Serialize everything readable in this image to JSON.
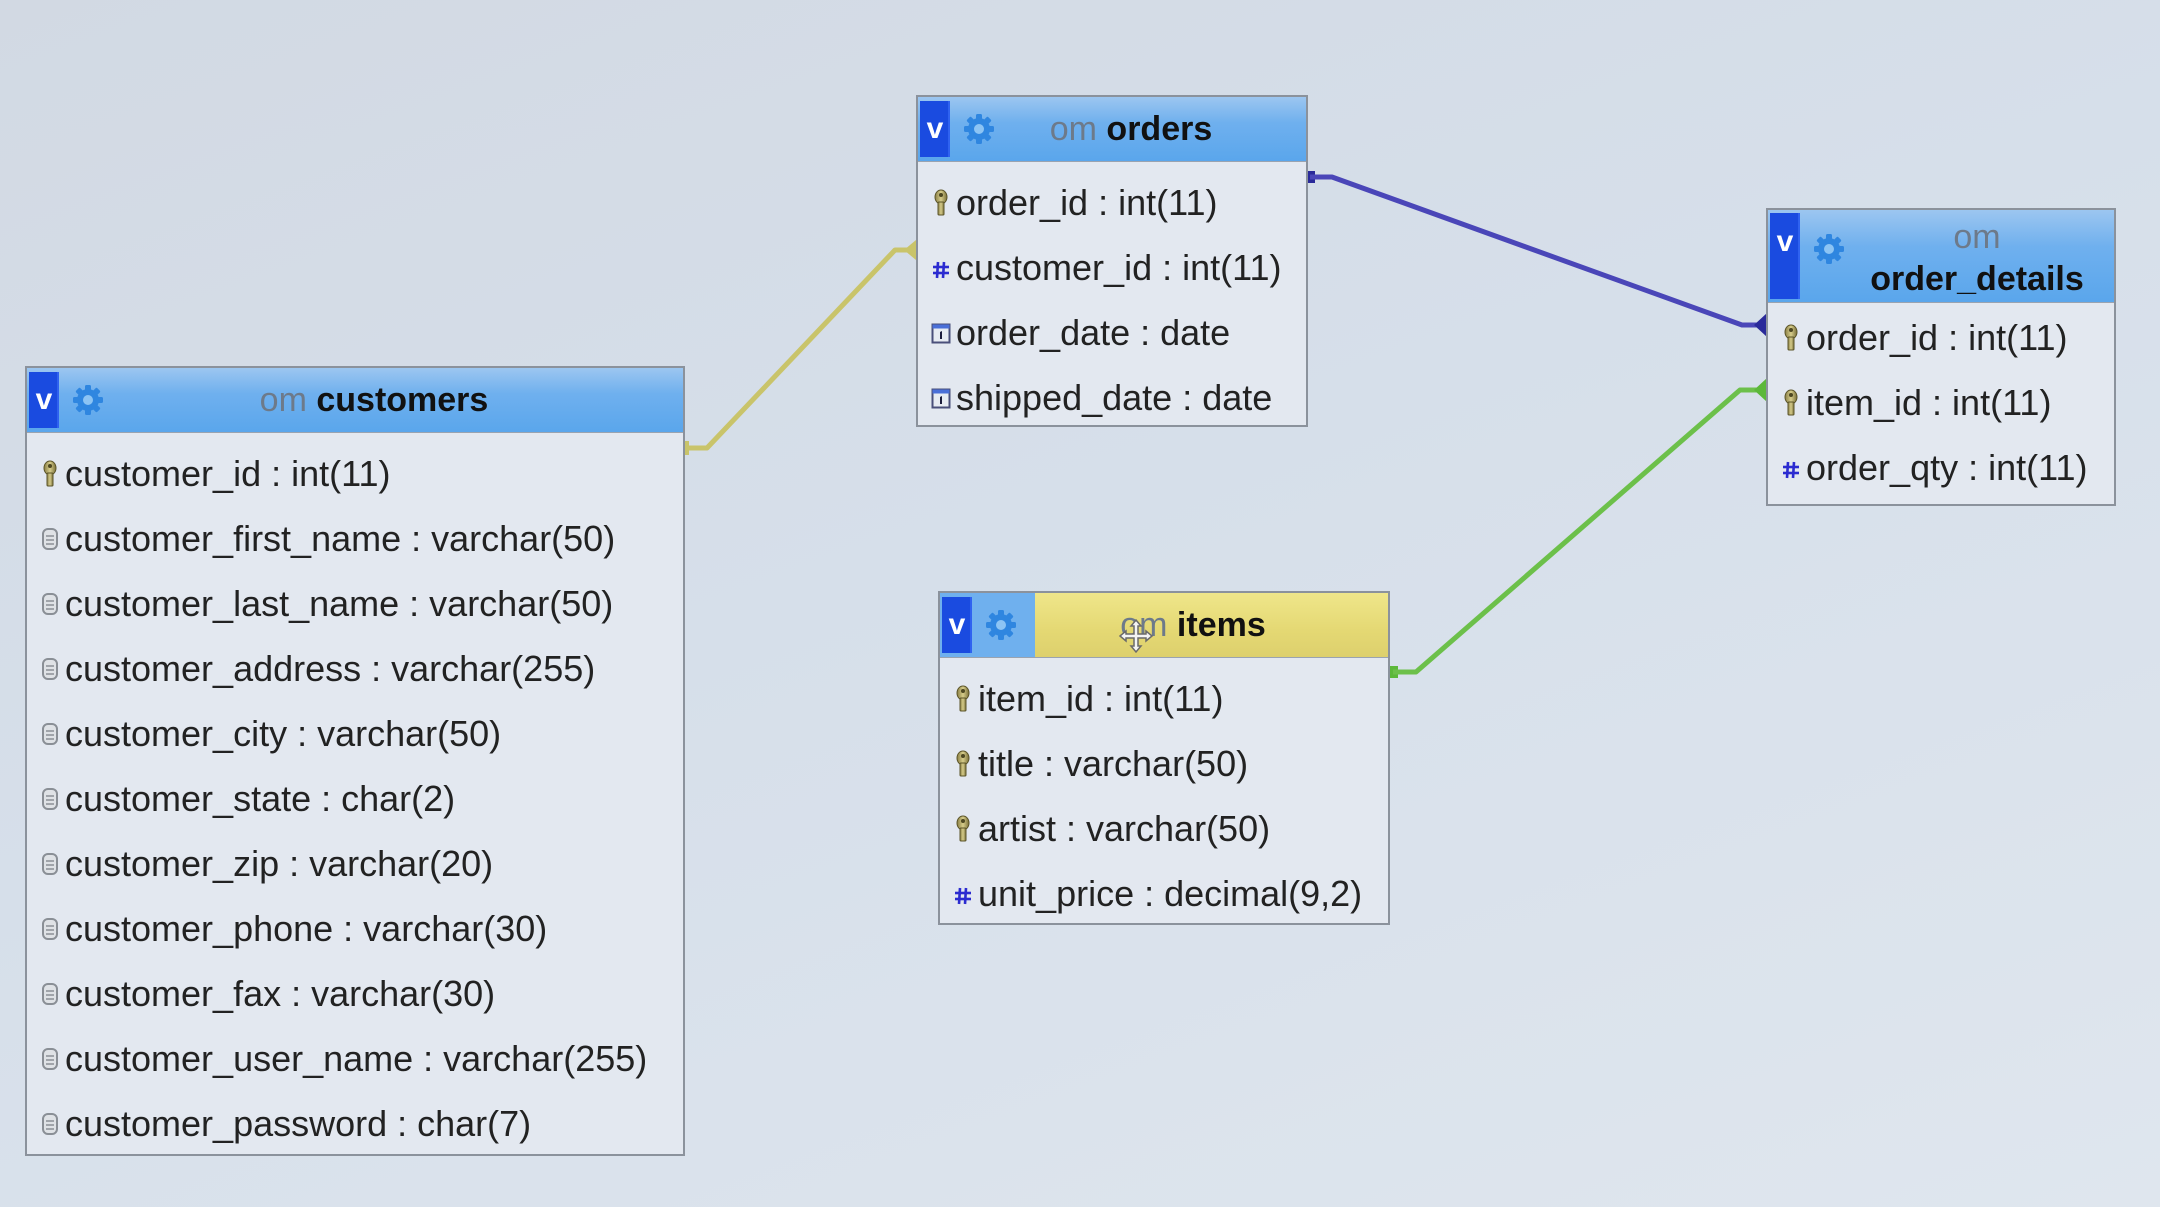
{
  "designer": {
    "database": "om",
    "colors": {
      "background": "#d6dfea",
      "header_blue": "#6fb0ee",
      "header_selected": "#e4d873",
      "toggle_blue": "#1a4be0",
      "relation_customers_orders": "#c9c46a",
      "relation_orders_order_details": "#4a46b8",
      "relation_items_order_details": "#6cc04a"
    },
    "tables": {
      "customers": {
        "db": "om",
        "name": "customers",
        "toggle_label": "v",
        "columns": [
          {
            "text": "customer_id : int(11)",
            "icon": "primary-key-icon"
          },
          {
            "text": "customer_first_name : varchar(50)",
            "icon": "text-column-icon"
          },
          {
            "text": "customer_last_name : varchar(50)",
            "icon": "text-column-icon"
          },
          {
            "text": "customer_address : varchar(255)",
            "icon": "text-column-icon"
          },
          {
            "text": "customer_city : varchar(50)",
            "icon": "text-column-icon"
          },
          {
            "text": "customer_state : char(2)",
            "icon": "text-column-icon"
          },
          {
            "text": "customer_zip : varchar(20)",
            "icon": "text-column-icon"
          },
          {
            "text": "customer_phone : varchar(30)",
            "icon": "text-column-icon"
          },
          {
            "text": "customer_fax : varchar(30)",
            "icon": "text-column-icon"
          },
          {
            "text": "customer_user_name : varchar(255)",
            "icon": "text-column-icon"
          },
          {
            "text": "customer_password : char(7)",
            "icon": "text-column-icon"
          }
        ]
      },
      "orders": {
        "db": "om",
        "name": "orders",
        "toggle_label": "v",
        "columns": [
          {
            "text": "order_id : int(11)",
            "icon": "primary-key-icon"
          },
          {
            "text": "customer_id : int(11)",
            "icon": "numeric-column-icon"
          },
          {
            "text": "order_date : date",
            "icon": "date-column-icon"
          },
          {
            "text": "shipped_date : date",
            "icon": "date-column-icon"
          }
        ]
      },
      "order_details": {
        "db": "om",
        "name": "order_details",
        "toggle_label": "v",
        "columns": [
          {
            "text": "order_id : int(11)",
            "icon": "primary-key-icon"
          },
          {
            "text": "item_id : int(11)",
            "icon": "primary-key-icon"
          },
          {
            "text": "order_qty : int(11)",
            "icon": "numeric-column-icon"
          }
        ]
      },
      "items": {
        "db": "om",
        "name": "items",
        "toggle_label": "v",
        "selected": true,
        "columns": [
          {
            "text": "item_id : int(11)",
            "icon": "primary-key-icon"
          },
          {
            "text": "title : varchar(50)",
            "icon": "primary-key-icon"
          },
          {
            "text": "artist : varchar(50)",
            "icon": "primary-key-icon"
          },
          {
            "text": "unit_price : decimal(9,2)",
            "icon": "numeric-column-icon"
          }
        ]
      }
    },
    "relations": [
      {
        "from": "customers.customer_id",
        "to": "orders.customer_id",
        "color": "#c9c46a"
      },
      {
        "from": "orders.order_id",
        "to": "order_details.order_id",
        "color": "#4a46b8"
      },
      {
        "from": "items.item_id",
        "to": "order_details.item_id",
        "color": "#6cc04a"
      }
    ]
  }
}
